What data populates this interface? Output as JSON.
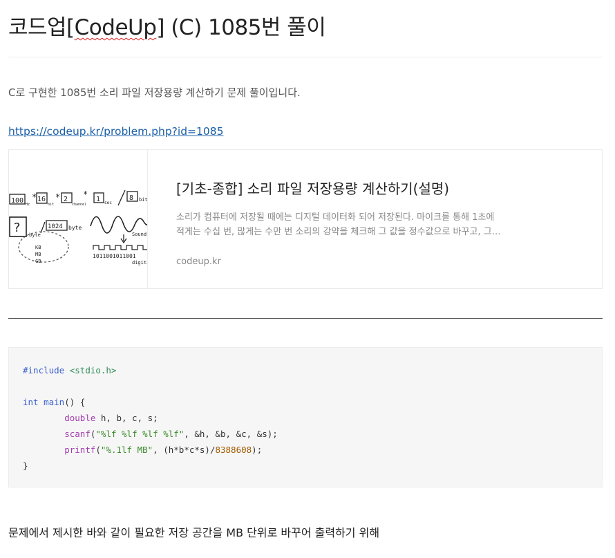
{
  "post": {
    "title_prefix": "코드업[",
    "title_spell": "CodeUp",
    "title_suffix": "] (C) 1085번 풀이",
    "intro": "C로 구현한 1085번 소리 파일 저장용량 계산하기 문제 풀이입니다.",
    "link_text": "https://codeup.kr/problem.php?id=1085",
    "outro": "문제에서 제시한 바와 같이 필요한 저장 공간을 MB 단위로 바꾸어 출력하기 위해"
  },
  "og_card": {
    "title": "[기초-종합] 소리 파일 저장용량 계산하기(설명)",
    "description": "소리가 컴퓨터에 저장될 때에는 디지털 데이터화 되어 저장된다. 마이크를 통해 1초에 적게는 수십 번, 많게는 수만 번 소리의 강약을 체크해 그 값을 정수값으로 바꾸고, 그 값을 저장해 소리를 파일로 저장할 수 있다.",
    "domain": "codeup.kr",
    "thumbnail": {
      "sketch_text": {
        "hz_value": "100",
        "hz_unit": "Hz",
        "bit_value": "16",
        "bit_unit": "bit",
        "channel_value": "2",
        "channel_unit": "channel",
        "sec_value": "1",
        "sec_unit": "sec",
        "divisor_value": "8",
        "divisor_unit": "bit",
        "question": "?",
        "byte_label": "byte",
        "kb_value": "1024",
        "kb_unit": "byte",
        "units": [
          "KB",
          "MB",
          "GB"
        ],
        "sound_label": "Sound",
        "binary": "1011001011001",
        "digital_label": "digital"
      }
    }
  },
  "code": {
    "include_directive": "#include",
    "include_header": "<stdio.h>",
    "main_type": "int",
    "main_name": "main",
    "main_rest": "() {",
    "decl_type": "double",
    "decl_vars": " h, b, c, s;",
    "scanf_fn": "scanf",
    "scanf_open": "(",
    "scanf_fmt": "\"%lf %lf %lf %lf\"",
    "scanf_args": ", &h, &b, &c, &s);",
    "printf_fn": "printf",
    "printf_open": "(",
    "printf_fmt": "\"%.1lf MB\"",
    "printf_expr": ", (h*b*c*s)/",
    "printf_num": "8388608",
    "printf_end": ");",
    "closing": "}"
  }
}
